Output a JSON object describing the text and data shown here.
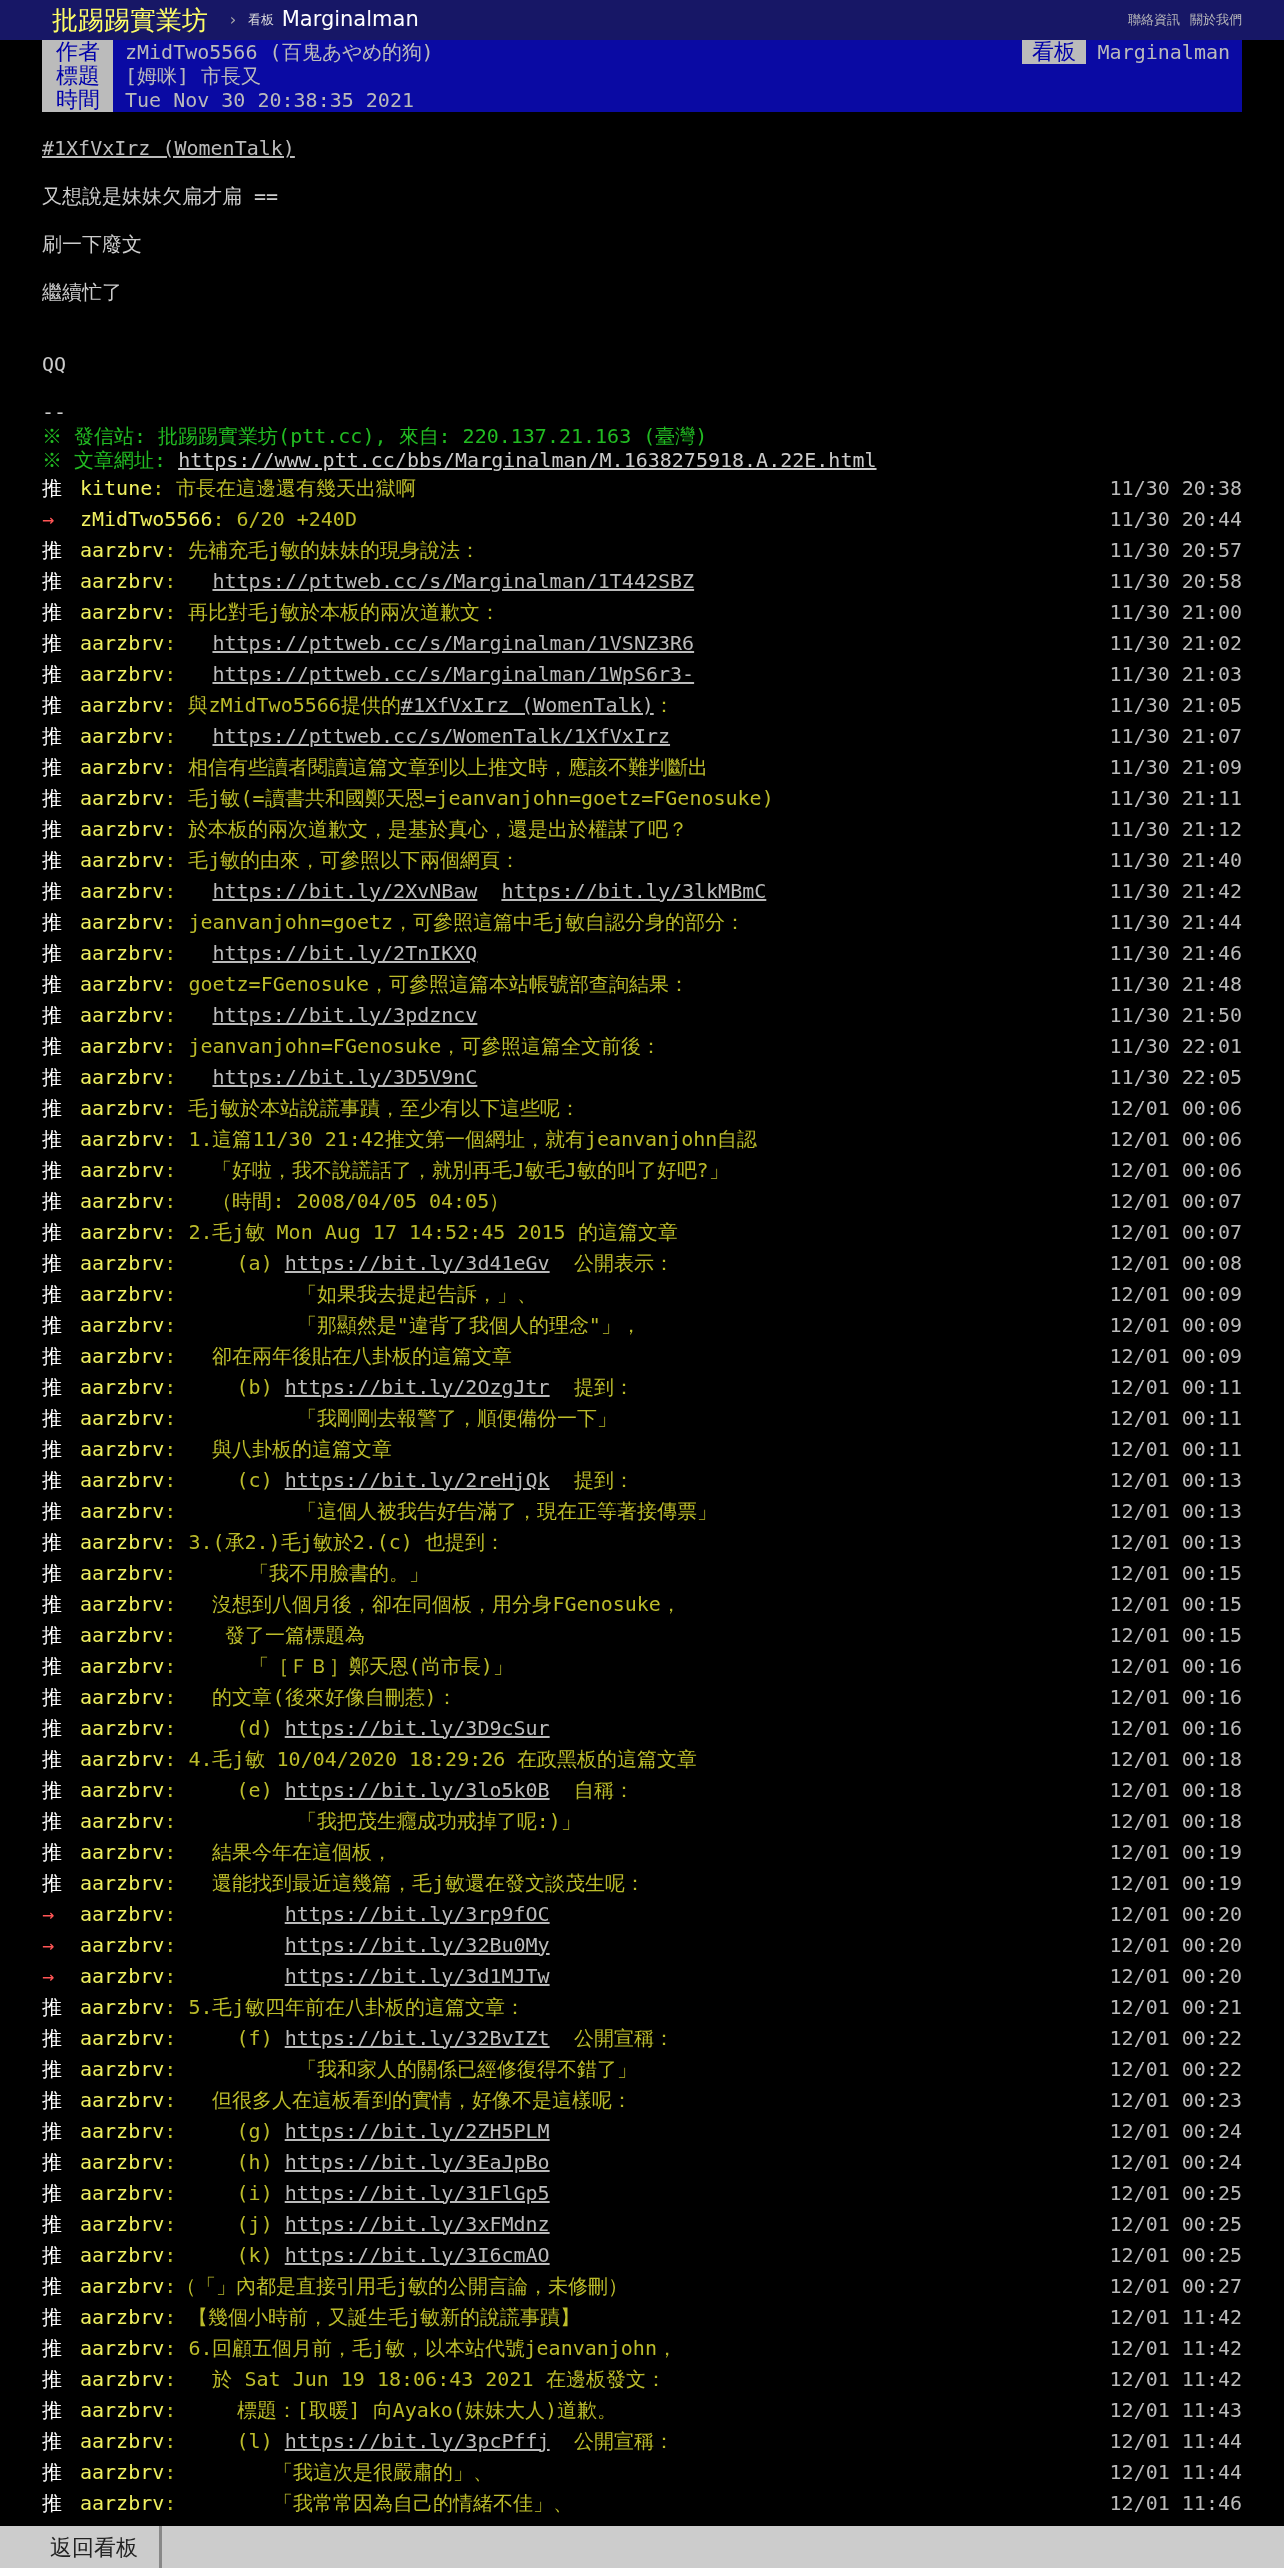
{
  "top_bar": {
    "site": "批踢踢實業坊",
    "separator": "›",
    "board_label": "看板",
    "board": "Marginalman",
    "links": [
      "聯絡資訊",
      "關於我們"
    ]
  },
  "meta": [
    {
      "label": "作者",
      "value": "zMidTwo5566 (百鬼あやめ的狗)"
    },
    {
      "label": "標題",
      "value": "[姆咪] 市長又"
    },
    {
      "label": "時間",
      "value": "Tue Nov 30 20:38:35 2021"
    }
  ],
  "meta_board": {
    "label": "看板",
    "value": "Marginalman"
  },
  "body": {
    "link": "#1XfVxIrz (WomenTalk)",
    "lines": [
      "又想說是妹妹欠扁才扁 ==",
      "刷一下廢文",
      "繼續忙了"
    ],
    "closing": "QQ"
  },
  "signature": {
    "separator": "--",
    "source": "※ 發信站: 批踢踢實業坊(ptt.cc), 來自: 220.137.21.163 (臺灣)",
    "url_label": "※ 文章網址: ",
    "url": "https://www.ptt.cc/bbs/Marginalman/M.1638275918.A.22E.html"
  },
  "pushes": [
    {
      "kind": "push",
      "tag": "推",
      "user": "kitune",
      "time": "11/30 20:38",
      "parts": [
        {
          "kind": "text",
          "text": ": 市長在這邊還有幾天出獄啊"
        }
      ]
    },
    {
      "kind": "arrow",
      "tag": "→",
      "user": "zMidTwo5566",
      "time": "11/30 20:44",
      "parts": [
        {
          "kind": "text",
          "text": ": 6/20 +240D"
        }
      ]
    },
    {
      "kind": "push",
      "tag": "推",
      "user": "aarzbrv",
      "time": "11/30 20:57",
      "parts": [
        {
          "kind": "text",
          "text": ": 先補充毛j敏的妹妹的現身說法："
        }
      ]
    },
    {
      "kind": "push",
      "tag": "推",
      "user": "aarzbrv",
      "time": "11/30 20:58",
      "parts": [
        {
          "kind": "text",
          "text": ":   "
        },
        {
          "kind": "link",
          "text": "https://pttweb.cc/s/Marginalman/1T442SBZ"
        }
      ]
    },
    {
      "kind": "push",
      "tag": "推",
      "user": "aarzbrv",
      "time": "11/30 21:00",
      "parts": [
        {
          "kind": "text",
          "text": ": 再比對毛j敏於本板的兩次道歉文："
        }
      ]
    },
    {
      "kind": "push",
      "tag": "推",
      "user": "aarzbrv",
      "time": "11/30 21:02",
      "parts": [
        {
          "kind": "text",
          "text": ":   "
        },
        {
          "kind": "link",
          "text": "https://pttweb.cc/s/Marginalman/1VSNZ3R6"
        }
      ]
    },
    {
      "kind": "push",
      "tag": "推",
      "user": "aarzbrv",
      "time": "11/30 21:03",
      "parts": [
        {
          "kind": "text",
          "text": ":   "
        },
        {
          "kind": "link",
          "text": "https://pttweb.cc/s/Marginalman/1WpS6r3-"
        }
      ]
    },
    {
      "kind": "push",
      "tag": "推",
      "user": "aarzbrv",
      "time": "11/30 21:05",
      "parts": [
        {
          "kind": "text",
          "text": ": 與zMidTwo5566提供的"
        },
        {
          "kind": "link",
          "text": "#1XfVxIrz (WomenTalk)"
        },
        {
          "kind": "text",
          "text": "："
        }
      ]
    },
    {
      "kind": "push",
      "tag": "推",
      "user": "aarzbrv",
      "time": "11/30 21:07",
      "parts": [
        {
          "kind": "text",
          "text": ":   "
        },
        {
          "kind": "link",
          "text": "https://pttweb.cc/s/WomenTalk/1XfVxIrz"
        }
      ]
    },
    {
      "kind": "push",
      "tag": "推",
      "user": "aarzbrv",
      "time": "11/30 21:09",
      "parts": [
        {
          "kind": "text",
          "text": ": 相信有些讀者閱讀這篇文章到以上推文時，應該不難判斷出"
        }
      ]
    },
    {
      "kind": "push",
      "tag": "推",
      "user": "aarzbrv",
      "time": "11/30 21:11",
      "parts": [
        {
          "kind": "text",
          "text": ": 毛j敏(=讀書共和國鄭天恩=jeanvanjohn=goetz=FGenosuke)"
        }
      ]
    },
    {
      "kind": "push",
      "tag": "推",
      "user": "aarzbrv",
      "time": "11/30 21:12",
      "parts": [
        {
          "kind": "text",
          "text": ": 於本板的兩次道歉文，是基於真心，還是出於權謀了吧？"
        }
      ]
    },
    {
      "kind": "push",
      "tag": "推",
      "user": "aarzbrv",
      "time": "11/30 21:40",
      "parts": [
        {
          "kind": "text",
          "text": ": 毛j敏的由來，可參照以下兩個網頁："
        }
      ]
    },
    {
      "kind": "push",
      "tag": "推",
      "user": "aarzbrv",
      "time": "11/30 21:42",
      "parts": [
        {
          "kind": "text",
          "text": ":   "
        },
        {
          "kind": "link",
          "text": "https://bit.ly/2XvNBaw"
        },
        {
          "kind": "link",
          "text": "https://bit.ly/3lkMBmC"
        }
      ]
    },
    {
      "kind": "push",
      "tag": "推",
      "user": "aarzbrv",
      "time": "11/30 21:44",
      "parts": [
        {
          "kind": "text",
          "text": ": jeanvanjohn=goetz，可參照這篇中毛j敏自認分身的部分："
        }
      ]
    },
    {
      "kind": "push",
      "tag": "推",
      "user": "aarzbrv",
      "time": "11/30 21:46",
      "parts": [
        {
          "kind": "text",
          "text": ":   "
        },
        {
          "kind": "link",
          "text": "https://bit.ly/2TnIKXQ"
        }
      ]
    },
    {
      "kind": "push",
      "tag": "推",
      "user": "aarzbrv",
      "time": "11/30 21:48",
      "parts": [
        {
          "kind": "text",
          "text": ": goetz=FGenosuke，可參照這篇本站帳號部查詢結果："
        }
      ]
    },
    {
      "kind": "push",
      "tag": "推",
      "user": "aarzbrv",
      "time": "11/30 21:50",
      "parts": [
        {
          "kind": "text",
          "text": ":   "
        },
        {
          "kind": "link",
          "text": "https://bit.ly/3pdzncv"
        }
      ]
    },
    {
      "kind": "push",
      "tag": "推",
      "user": "aarzbrv",
      "time": "11/30 22:01",
      "parts": [
        {
          "kind": "text",
          "text": ": jeanvanjohn=FGenosuke，可參照這篇全文前後："
        }
      ]
    },
    {
      "kind": "push",
      "tag": "推",
      "user": "aarzbrv",
      "time": "11/30 22:05",
      "parts": [
        {
          "kind": "text",
          "text": ":   "
        },
        {
          "kind": "link",
          "text": "https://bit.ly/3D5V9nC"
        }
      ]
    },
    {
      "kind": "push",
      "tag": "推",
      "user": "aarzbrv",
      "time": "12/01 00:06",
      "parts": [
        {
          "kind": "text",
          "text": ": 毛j敏於本站說謊事蹟，至少有以下這些呢："
        }
      ]
    },
    {
      "kind": "push",
      "tag": "推",
      "user": "aarzbrv",
      "time": "12/01 00:06",
      "parts": [
        {
          "kind": "text",
          "text": ": 1.這篇11/30 21:42推文第一個網址，就有jeanvanjohn自認"
        }
      ]
    },
    {
      "kind": "push",
      "tag": "推",
      "user": "aarzbrv",
      "time": "12/01 00:06",
      "parts": [
        {
          "kind": "text",
          "text": ":   「好啦，我不說謊話了，就別再毛J敏毛J敏的叫了好吧?」"
        }
      ]
    },
    {
      "kind": "push",
      "tag": "推",
      "user": "aarzbrv",
      "time": "12/01 00:07",
      "parts": [
        {
          "kind": "text",
          "text": ":   （時間: 2008/04/05 04:05）"
        }
      ]
    },
    {
      "kind": "push",
      "tag": "推",
      "user": "aarzbrv",
      "time": "12/01 00:07",
      "parts": [
        {
          "kind": "text",
          "text": ": 2.毛j敏 Mon Aug 17 14:52:45 2015 的這篇文章"
        }
      ]
    },
    {
      "kind": "push",
      "tag": "推",
      "user": "aarzbrv",
      "time": "12/01 00:08",
      "parts": [
        {
          "kind": "text",
          "text": ":     (a) "
        },
        {
          "kind": "link",
          "text": "https://bit.ly/3d41eGv"
        },
        {
          "kind": "text",
          "text": "  公開表示："
        }
      ]
    },
    {
      "kind": "push",
      "tag": "推",
      "user": "aarzbrv",
      "time": "12/01 00:09",
      "parts": [
        {
          "kind": "text",
          "text": ":          「如果我去提起告訴，」、"
        }
      ]
    },
    {
      "kind": "push",
      "tag": "推",
      "user": "aarzbrv",
      "time": "12/01 00:09",
      "parts": [
        {
          "kind": "text",
          "text": ":          「那顯然是\"違背了我個人的理念\"」，"
        }
      ]
    },
    {
      "kind": "push",
      "tag": "推",
      "user": "aarzbrv",
      "time": "12/01 00:09",
      "parts": [
        {
          "kind": "text",
          "text": ":   卻在兩年後貼在八卦板的這篇文章"
        }
      ]
    },
    {
      "kind": "push",
      "tag": "推",
      "user": "aarzbrv",
      "time": "12/01 00:11",
      "parts": [
        {
          "kind": "text",
          "text": ":     (b) "
        },
        {
          "kind": "link",
          "text": "https://bit.ly/2OzgJtr"
        },
        {
          "kind": "text",
          "text": "  提到："
        }
      ]
    },
    {
      "kind": "push",
      "tag": "推",
      "user": "aarzbrv",
      "time": "12/01 00:11",
      "parts": [
        {
          "kind": "text",
          "text": ":          「我剛剛去報警了，順便備份一下」"
        }
      ]
    },
    {
      "kind": "push",
      "tag": "推",
      "user": "aarzbrv",
      "time": "12/01 00:11",
      "parts": [
        {
          "kind": "text",
          "text": ":   與八卦板的這篇文章"
        }
      ]
    },
    {
      "kind": "push",
      "tag": "推",
      "user": "aarzbrv",
      "time": "12/01 00:13",
      "parts": [
        {
          "kind": "text",
          "text": ":     (c) "
        },
        {
          "kind": "link",
          "text": "https://bit.ly/2reHjQk"
        },
        {
          "kind": "text",
          "text": "  提到："
        }
      ]
    },
    {
      "kind": "push",
      "tag": "推",
      "user": "aarzbrv",
      "time": "12/01 00:13",
      "parts": [
        {
          "kind": "text",
          "text": ":          「這個人被我告好告滿了，現在正等著接傳票」"
        }
      ]
    },
    {
      "kind": "push",
      "tag": "推",
      "user": "aarzbrv",
      "time": "12/01 00:13",
      "parts": [
        {
          "kind": "text",
          "text": ": 3.(承2.)毛j敏於2.(c) 也提到："
        }
      ]
    },
    {
      "kind": "push",
      "tag": "推",
      "user": "aarzbrv",
      "time": "12/01 00:15",
      "parts": [
        {
          "kind": "text",
          "text": ":      「我不用臉書的。」"
        }
      ]
    },
    {
      "kind": "push",
      "tag": "推",
      "user": "aarzbrv",
      "time": "12/01 00:15",
      "parts": [
        {
          "kind": "text",
          "text": ":   沒想到八個月後，卻在同個板，用分身FGenosuke，"
        }
      ]
    },
    {
      "kind": "push",
      "tag": "推",
      "user": "aarzbrv",
      "time": "12/01 00:15",
      "parts": [
        {
          "kind": "text",
          "text": ":    發了一篇標題為"
        }
      ]
    },
    {
      "kind": "push",
      "tag": "推",
      "user": "aarzbrv",
      "time": "12/01 00:16",
      "parts": [
        {
          "kind": "text",
          "text": ":      「［ＦＢ］鄭天恩(尚市長)」"
        }
      ]
    },
    {
      "kind": "push",
      "tag": "推",
      "user": "aarzbrv",
      "time": "12/01 00:16",
      "parts": [
        {
          "kind": "text",
          "text": ":   的文章(後來好像自刪惹)："
        }
      ]
    },
    {
      "kind": "push",
      "tag": "推",
      "user": "aarzbrv",
      "time": "12/01 00:16",
      "parts": [
        {
          "kind": "text",
          "text": ":     (d) "
        },
        {
          "kind": "link",
          "text": "https://bit.ly/3D9cSur"
        }
      ]
    },
    {
      "kind": "push",
      "tag": "推",
      "user": "aarzbrv",
      "time": "12/01 00:18",
      "parts": [
        {
          "kind": "text",
          "text": ": 4.毛j敏 10/04/2020 18:29:26 在政黑板的這篇文章"
        }
      ]
    },
    {
      "kind": "push",
      "tag": "推",
      "user": "aarzbrv",
      "time": "12/01 00:18",
      "parts": [
        {
          "kind": "text",
          "text": ":     (e) "
        },
        {
          "kind": "link",
          "text": "https://bit.ly/3lo5k0B"
        },
        {
          "kind": "text",
          "text": "  自稱："
        }
      ]
    },
    {
      "kind": "push",
      "tag": "推",
      "user": "aarzbrv",
      "time": "12/01 00:18",
      "parts": [
        {
          "kind": "text",
          "text": ":          「我把茂生癮成功戒掉了呢:)」"
        }
      ]
    },
    {
      "kind": "push",
      "tag": "推",
      "user": "aarzbrv",
      "time": "12/01 00:19",
      "parts": [
        {
          "kind": "text",
          "text": ":   結果今年在這個板，"
        }
      ]
    },
    {
      "kind": "push",
      "tag": "推",
      "user": "aarzbrv",
      "time": "12/01 00:19",
      "parts": [
        {
          "kind": "text",
          "text": ":   還能找到最近這幾篇，毛j敏還在發文談茂生呢："
        }
      ]
    },
    {
      "kind": "arrow",
      "tag": "→",
      "user": "aarzbrv",
      "time": "12/01 00:20",
      "parts": [
        {
          "kind": "text",
          "text": ":         "
        },
        {
          "kind": "link",
          "text": "https://bit.ly/3rp9fOC"
        }
      ]
    },
    {
      "kind": "arrow",
      "tag": "→",
      "user": "aarzbrv",
      "time": "12/01 00:20",
      "parts": [
        {
          "kind": "text",
          "text": ":         "
        },
        {
          "kind": "link",
          "text": "https://bit.ly/32Bu0My"
        }
      ]
    },
    {
      "kind": "arrow",
      "tag": "→",
      "user": "aarzbrv",
      "time": "12/01 00:20",
      "parts": [
        {
          "kind": "text",
          "text": ":         "
        },
        {
          "kind": "link",
          "text": "https://bit.ly/3d1MJTw"
        }
      ]
    },
    {
      "kind": "push",
      "tag": "推",
      "user": "aarzbrv",
      "time": "12/01 00:21",
      "parts": [
        {
          "kind": "text",
          "text": ": 5.毛j敏四年前在八卦板的這篇文章："
        }
      ]
    },
    {
      "kind": "push",
      "tag": "推",
      "user": "aarzbrv",
      "time": "12/01 00:22",
      "parts": [
        {
          "kind": "text",
          "text": ":     (f) "
        },
        {
          "kind": "link",
          "text": "https://bit.ly/32BvIZt"
        },
        {
          "kind": "text",
          "text": "  公開宣稱："
        }
      ]
    },
    {
      "kind": "push",
      "tag": "推",
      "user": "aarzbrv",
      "time": "12/01 00:22",
      "parts": [
        {
          "kind": "text",
          "text": ":          「我和家人的關係已經修復得不錯了」"
        }
      ]
    },
    {
      "kind": "push",
      "tag": "推",
      "user": "aarzbrv",
      "time": "12/01 00:23",
      "parts": [
        {
          "kind": "text",
          "text": ":   但很多人在這板看到的實情，好像不是這樣呢："
        }
      ]
    },
    {
      "kind": "push",
      "tag": "推",
      "user": "aarzbrv",
      "time": "12/01 00:24",
      "parts": [
        {
          "kind": "text",
          "text": ":     (g) "
        },
        {
          "kind": "link",
          "text": "https://bit.ly/2ZH5PLM"
        }
      ]
    },
    {
      "kind": "push",
      "tag": "推",
      "user": "aarzbrv",
      "time": "12/01 00:24",
      "parts": [
        {
          "kind": "text",
          "text": ":     (h) "
        },
        {
          "kind": "link",
          "text": "https://bit.ly/3EaJpBo"
        }
      ]
    },
    {
      "kind": "push",
      "tag": "推",
      "user": "aarzbrv",
      "time": "12/01 00:25",
      "parts": [
        {
          "kind": "text",
          "text": ":     (i) "
        },
        {
          "kind": "link",
          "text": "https://bit.ly/31FlGp5"
        }
      ]
    },
    {
      "kind": "push",
      "tag": "推",
      "user": "aarzbrv",
      "time": "12/01 00:25",
      "parts": [
        {
          "kind": "text",
          "text": ":     (j) "
        },
        {
          "kind": "link",
          "text": "https://bit.ly/3xFMdnz"
        }
      ]
    },
    {
      "kind": "push",
      "tag": "推",
      "user": "aarzbrv",
      "time": "12/01 00:25",
      "parts": [
        {
          "kind": "text",
          "text": ":     (k) "
        },
        {
          "kind": "link",
          "text": "https://bit.ly/3I6cmAO"
        }
      ]
    },
    {
      "kind": "push",
      "tag": "推",
      "user": "aarzbrv",
      "time": "12/01 00:27",
      "parts": [
        {
          "kind": "text",
          "text": ":（「」內都是直接引用毛j敏的公開言論，未修刪）"
        }
      ]
    },
    {
      "kind": "push",
      "tag": "推",
      "user": "aarzbrv",
      "time": "12/01 11:42",
      "parts": [
        {
          "kind": "text",
          "text": ": 【幾個小時前，又誕生毛j敏新的說謊事蹟】"
        }
      ]
    },
    {
      "kind": "push",
      "tag": "推",
      "user": "aarzbrv",
      "time": "12/01 11:42",
      "parts": [
        {
          "kind": "text",
          "text": ": 6.回顧五個月前，毛j敏，以本站代號jeanvanjohn，"
        }
      ]
    },
    {
      "kind": "push",
      "tag": "推",
      "user": "aarzbrv",
      "time": "12/01 11:42",
      "parts": [
        {
          "kind": "text",
          "text": ":   於 Sat Jun 19 18:06:43 2021 在邊板發文："
        }
      ]
    },
    {
      "kind": "push",
      "tag": "推",
      "user": "aarzbrv",
      "time": "12/01 11:43",
      "parts": [
        {
          "kind": "text",
          "text": ":     標題：[取暖] 向Ayako(妹妹大人)道歉。"
        }
      ]
    },
    {
      "kind": "push",
      "tag": "推",
      "user": "aarzbrv",
      "time": "12/01 11:44",
      "parts": [
        {
          "kind": "text",
          "text": ":     (l) "
        },
        {
          "kind": "link",
          "text": "https://bit.ly/3pcPffj"
        },
        {
          "kind": "text",
          "text": "  公開宣稱："
        }
      ]
    },
    {
      "kind": "push",
      "tag": "推",
      "user": "aarzbrv",
      "time": "12/01 11:44",
      "parts": [
        {
          "kind": "text",
          "text": ":        「我這次是很嚴肅的」、"
        }
      ]
    },
    {
      "kind": "push",
      "tag": "推",
      "user": "aarzbrv",
      "time": "12/01 11:46",
      "parts": [
        {
          "kind": "text",
          "text": ":        「我常常因為自己的情緒不佳」、"
        }
      ]
    }
  ],
  "bottom_bar": {
    "button": "返回看板"
  }
}
